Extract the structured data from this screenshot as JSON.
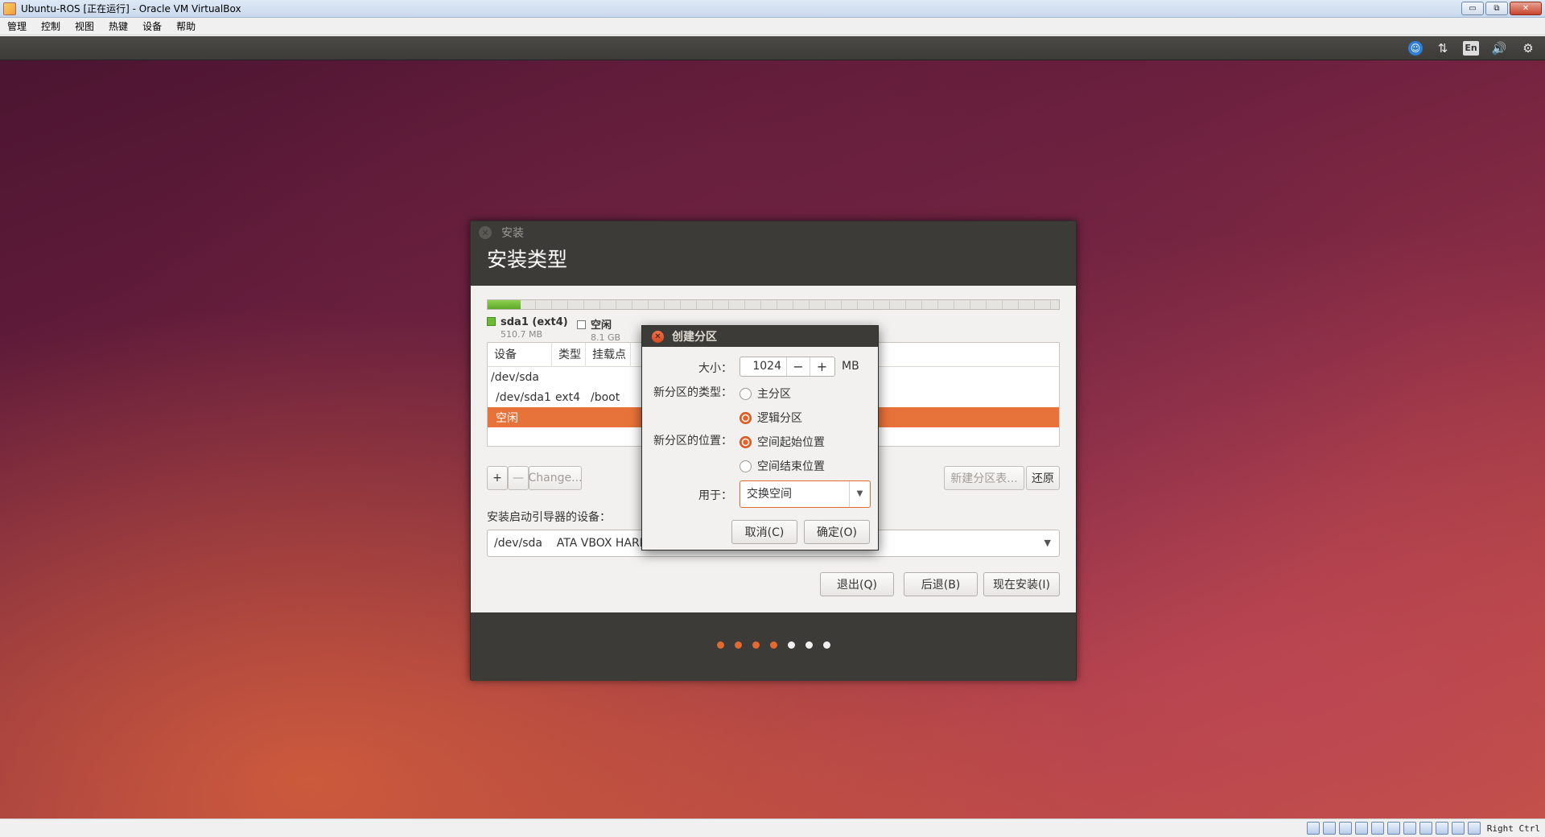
{
  "host_window": {
    "title": "Ubuntu-ROS [正在运行] - Oracle VM VirtualBox",
    "controls": {
      "minimize": "▭",
      "restore": "⧉",
      "close": "✕"
    },
    "menu": [
      "管理",
      "控制",
      "视图",
      "热键",
      "设备",
      "帮助"
    ],
    "host_key": "Right Ctrl"
  },
  "ubuntu_panel": {
    "accessibility_glyph": "☺",
    "network_glyph": "⇅",
    "keyboard_layout": "En",
    "volume_glyph": "🔊",
    "settings_glyph": "⚙"
  },
  "installer": {
    "window_title": "安装",
    "close_glyph": "✕",
    "heading": "安装类型",
    "legend": [
      {
        "name": "sda1 (ext4)",
        "size": "510.7 MB",
        "color": "#6dbb35"
      },
      {
        "name": "空闲",
        "size": "8.1 GB",
        "color": "#ffffff"
      }
    ],
    "table": {
      "columns": [
        "设备",
        "类型",
        "挂载点"
      ],
      "rows": [
        {
          "device": "/dev/sda",
          "type": "",
          "mount": ""
        },
        {
          "device": "/dev/sda1",
          "type": "ext4",
          "mount": "/boot"
        },
        {
          "device": "空闲",
          "type": "",
          "mount": "",
          "selected": true
        }
      ]
    },
    "toolbar": {
      "add": "+",
      "remove": "—",
      "change": "Change...",
      "new_table": "新建分区表...",
      "revert": "还原"
    },
    "boot_device_label": "安装启动引导器的设备：",
    "boot_device_value": "/dev/sda    ATA VBOX HARDDISK (8.6 GB)",
    "boot_device_arrow": "▼",
    "buttons": {
      "quit": "退出(Q)",
      "back": "后退(B)",
      "install_now": "现在安装(I)"
    },
    "progress": {
      "done": 4,
      "total": 7
    },
    "accent_color": "#e8733a"
  },
  "create_partition_dialog": {
    "title": "创建分区",
    "close_glyph": "✕",
    "size_label": "大小：",
    "size_value": "1024",
    "size_unit": "MB",
    "minus": "−",
    "plus": "+",
    "type_label": "新分区的类型：",
    "type_options": [
      {
        "label": "主分区",
        "checked": false
      },
      {
        "label": "逻辑分区",
        "checked": true
      }
    ],
    "location_label": "新分区的位置：",
    "location_options": [
      {
        "label": "空间起始位置",
        "checked": true
      },
      {
        "label": "空间结束位置",
        "checked": false
      }
    ],
    "use_label": "用于：",
    "use_value": "交换空间",
    "use_arrow": "▼",
    "cancel": "取消(C)",
    "ok": "确定(O)"
  }
}
